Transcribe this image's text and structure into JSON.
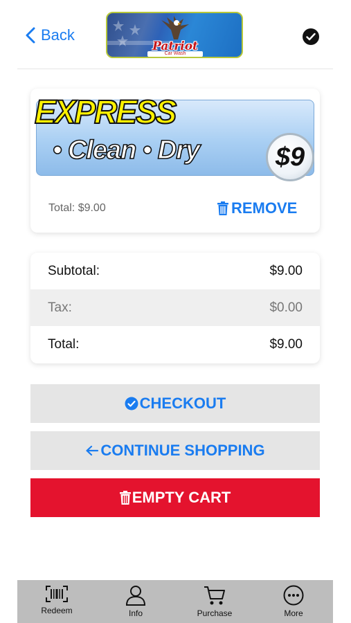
{
  "header": {
    "back_label": "Back",
    "logo": {
      "brand": "Patriot",
      "sub": "Car Wash"
    }
  },
  "product": {
    "banner_title": "EXPRESS",
    "banner_features": "• Clean • Dry",
    "banner_price": "$9",
    "total_text": "Total: $9.00",
    "remove_label": "REMOVE"
  },
  "summary": {
    "rows": [
      {
        "label": "Subtotal:",
        "value": "$9.00"
      },
      {
        "label": "Tax:",
        "value": "$0.00"
      },
      {
        "label": "Total:",
        "value": "$9.00"
      }
    ]
  },
  "actions": {
    "checkout_label": "CHECKOUT",
    "continue_label": "CONTINUE SHOPPING",
    "empty_label": "EMPTY CART"
  },
  "tabbar": {
    "items": [
      {
        "label": "Redeem",
        "icon": "barcode-icon"
      },
      {
        "label": "Info",
        "icon": "person-icon"
      },
      {
        "label": "Purchase",
        "icon": "cart-icon"
      },
      {
        "label": "More",
        "icon": "more-icon"
      }
    ]
  },
  "colors": {
    "accent": "#1a7cf0",
    "danger": "#e4132e",
    "button_bg": "#e5e5e5",
    "tabbar_bg": "#bdbdbd",
    "express_yellow": "#fff200"
  }
}
